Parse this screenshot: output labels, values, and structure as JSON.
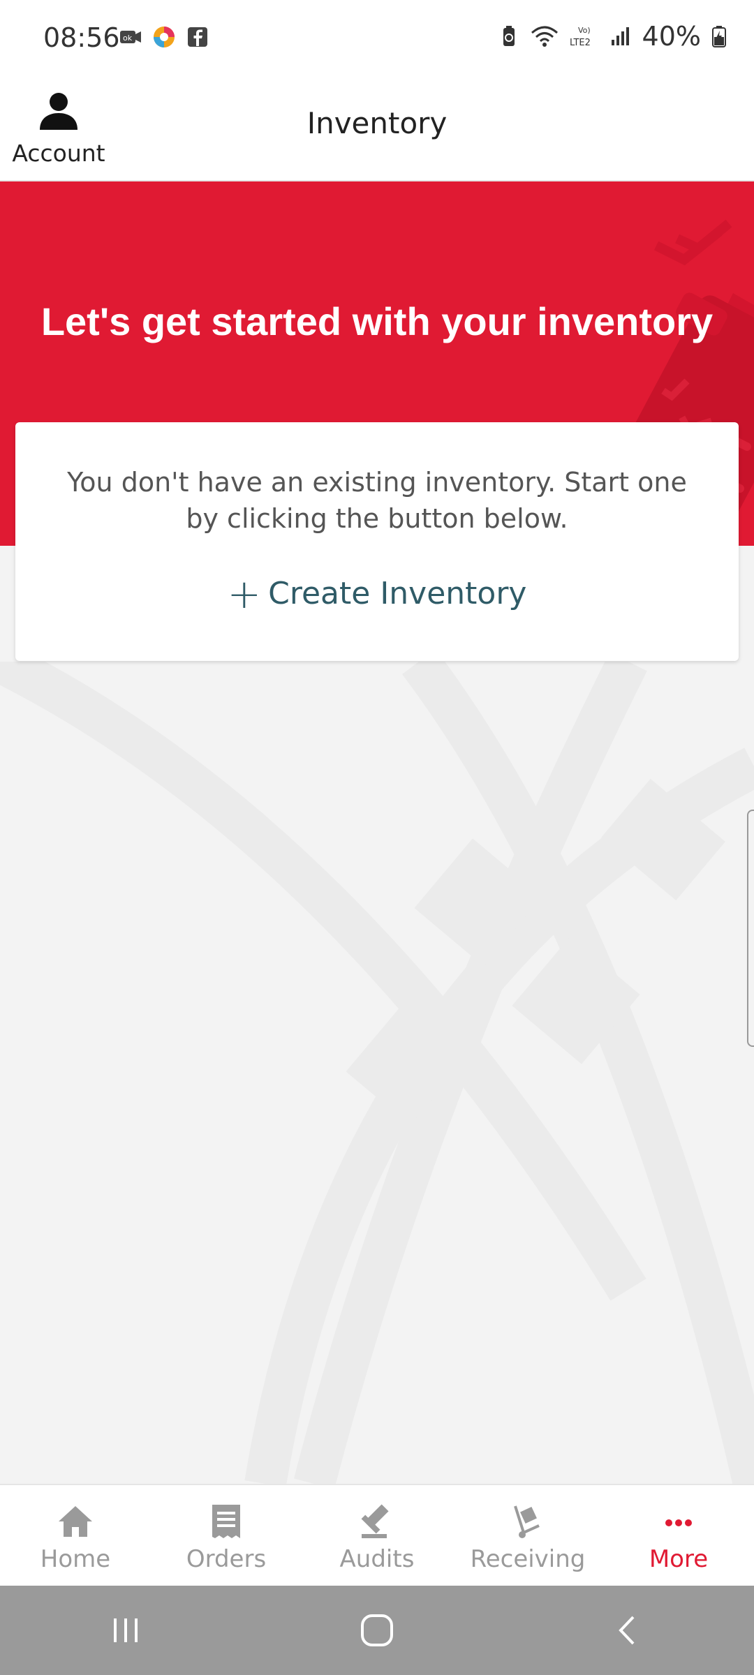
{
  "status_bar": {
    "time": "08:56",
    "battery": "40%",
    "left_icons": [
      "video-call-icon",
      "browser-icon",
      "facebook-icon"
    ],
    "right_icons": [
      "battery-saver-icon",
      "wifi-icon",
      "volte-lte2-icon",
      "signal-icon",
      "battery-icon"
    ]
  },
  "header": {
    "account_label": "Account",
    "title": "Inventory"
  },
  "hero": {
    "title": "Let's get started with your inventory"
  },
  "card": {
    "message": "You don't have an existing inventory. Start one by clicking the button below.",
    "create_label": "Create Inventory"
  },
  "bottom_nav": {
    "items": [
      {
        "label": "Home",
        "icon": "home-icon",
        "active": false
      },
      {
        "label": "Orders",
        "icon": "receipt-icon",
        "active": false
      },
      {
        "label": "Audits",
        "icon": "gavel-icon",
        "active": false
      },
      {
        "label": "Receiving",
        "icon": "hand-truck-icon",
        "active": false
      },
      {
        "label": "More",
        "icon": "more-dots-icon",
        "active": true
      }
    ]
  },
  "colors": {
    "brand_red": "#e01a33",
    "accent_teal": "#2f5b67",
    "inactive_gray": "#9a9a9a"
  }
}
